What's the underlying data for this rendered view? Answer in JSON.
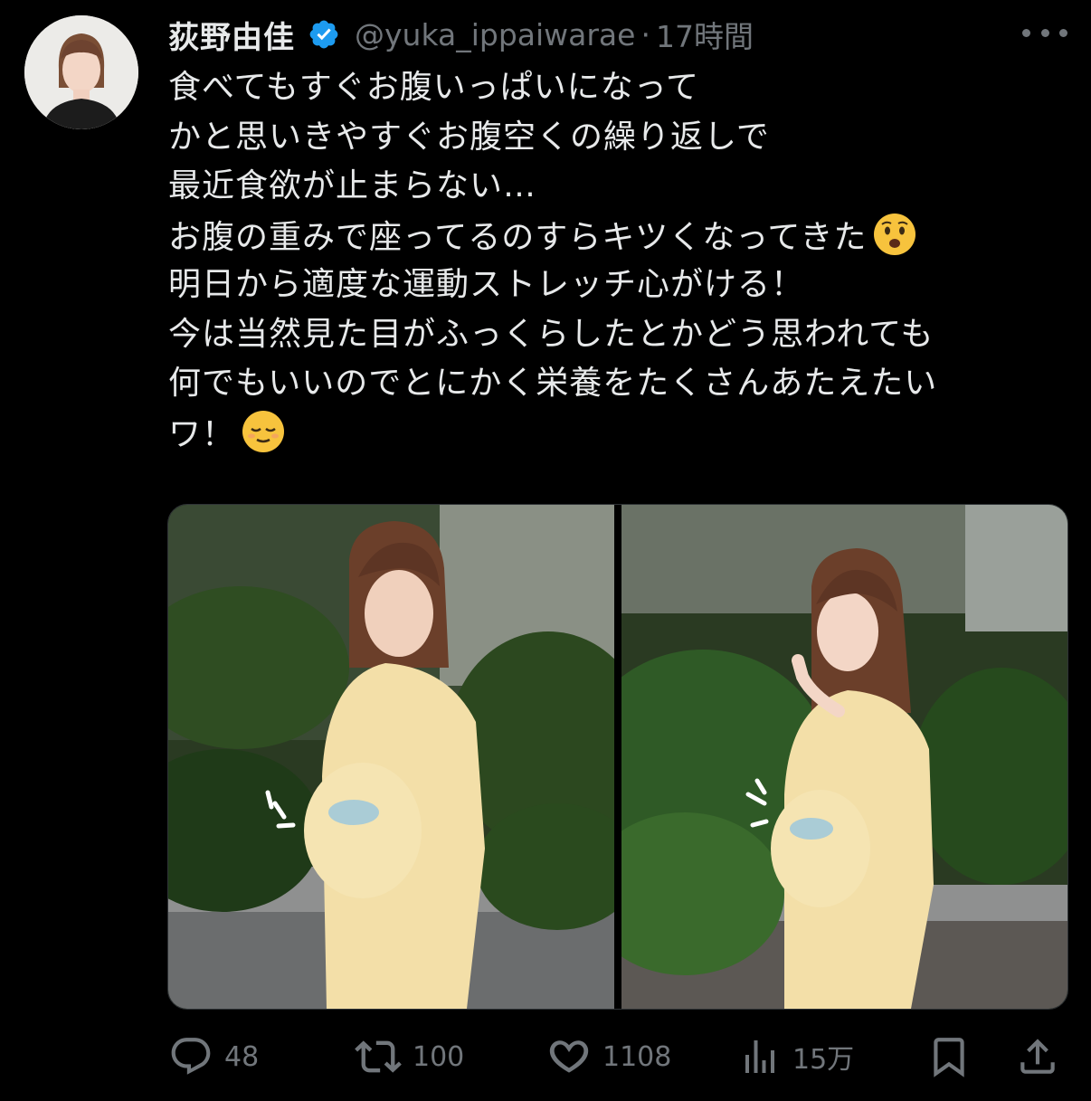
{
  "tweet": {
    "author_name": "荻野由佳",
    "handle": "@yuka_ippaiwarae",
    "separator": "·",
    "time": "17時間",
    "lines": [
      "食べてもすぐお腹いっぱいになって",
      "かと思いきやすぐお腹空くの繰り返しで",
      "最近食欲が止まらない…",
      "お腹の重みで座ってるのすらキツくなってきた",
      "明日から適度な運動ストレッチ心がける！",
      "今は当然見た目がふっくらしたとかどう思われても",
      "何でもいいのでとにかく栄養をたくさんあたえたい",
      "ワ！"
    ],
    "emojis": [
      "anguished-face-emoji",
      "relieved-face-emoji"
    ]
  },
  "actions": {
    "replies": "48",
    "reposts": "100",
    "likes": "1108",
    "views": "15万"
  },
  "icons": {
    "verified": "verified-badge-icon",
    "more": "more-icon",
    "reply": "reply-icon",
    "repost": "repost-icon",
    "like": "like-icon",
    "views": "views-icon",
    "bookmark": "bookmark-icon",
    "share": "share-icon"
  },
  "colors": {
    "background": "#000000",
    "text": "#e7e9ea",
    "muted": "#71767b",
    "verified": "#1d9bf0"
  }
}
